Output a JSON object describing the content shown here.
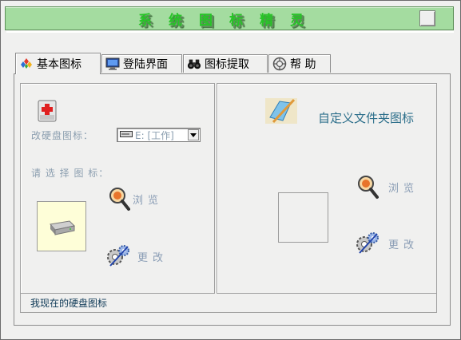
{
  "window": {
    "title": "系统图标精灵"
  },
  "tabs": [
    {
      "label": "基本图标",
      "icon": "diamond-cards-icon",
      "active": true
    },
    {
      "label": "登陆界面",
      "icon": "monitor-icon",
      "active": false
    },
    {
      "label": "图标提取",
      "icon": "binoculars-icon",
      "active": false
    },
    {
      "label": "帮 助",
      "icon": "lifebuoy-help-icon",
      "active": false
    }
  ],
  "left_panel": {
    "change_disk_label": "改硬盘图标：",
    "drive_select_value": "E: [工作]",
    "choose_icon_label": "请 选 择 图 标：",
    "browse_label": "浏览",
    "change_label": "更改"
  },
  "right_panel": {
    "title": "自定义文件夹图标",
    "browse_label": "浏览",
    "change_label": "更改"
  },
  "status": {
    "text": "我现在的硬盘图标"
  },
  "colors": {
    "title_bar": "#a4dca0",
    "title_text": "#27c427",
    "label_grey": "#8c9fb0",
    "status_text": "#0f3a57",
    "custom_title": "#2d6f8b",
    "preview_bg": "#fefed8"
  }
}
